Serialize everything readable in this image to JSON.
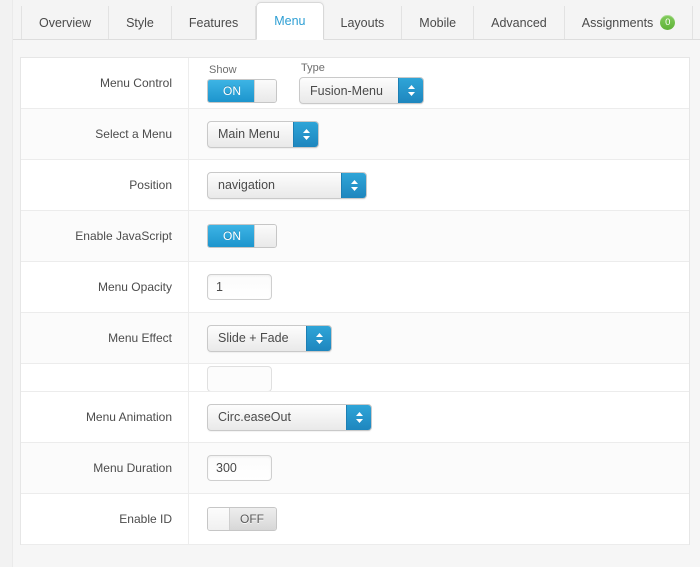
{
  "tabs": [
    {
      "label": "Overview",
      "active": false
    },
    {
      "label": "Style",
      "active": false
    },
    {
      "label": "Features",
      "active": false
    },
    {
      "label": "Menu",
      "active": true
    },
    {
      "label": "Layouts",
      "active": false
    },
    {
      "label": "Mobile",
      "active": false
    },
    {
      "label": "Advanced",
      "active": false
    },
    {
      "label": "Assignments",
      "active": false,
      "badge": "0"
    }
  ],
  "rows": {
    "menu_control": {
      "label": "Menu Control",
      "show_sub_label": "Show",
      "show_state": "ON",
      "type_sub_label": "Type",
      "type_value": "Fusion-Menu"
    },
    "select_a_menu": {
      "label": "Select a Menu",
      "value": "Main Menu"
    },
    "position": {
      "label": "Position",
      "value": "navigation"
    },
    "enable_javascript": {
      "label": "Enable JavaScript",
      "state": "ON"
    },
    "menu_opacity": {
      "label": "Menu Opacity",
      "value": "1"
    },
    "menu_effect": {
      "label": "Menu Effect",
      "value": "Slide + Fade"
    },
    "clipped_row": {
      "label": "",
      "value": ""
    },
    "menu_animation": {
      "label": "Menu Animation",
      "value": "Circ.easeOut"
    },
    "menu_duration": {
      "label": "Menu Duration",
      "value": "300"
    },
    "enable_id": {
      "label": "Enable ID",
      "state": "OFF"
    }
  },
  "colors": {
    "accent_blue": "#2fa5d8",
    "toggle_on_blue": "#1d95cd",
    "badge_green": "#6cbd45",
    "active_tab_text": "#2e9fd4",
    "panel_bg": "#ffffff",
    "row_alt_bg": "#fbfbfb"
  }
}
